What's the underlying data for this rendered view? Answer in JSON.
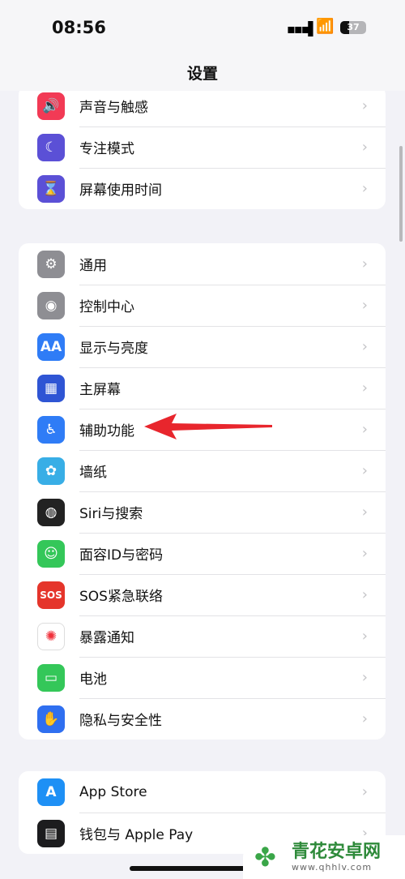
{
  "status": {
    "time": "08:56",
    "battery": "37"
  },
  "header": {
    "title": "设置"
  },
  "groups": [
    [
      {
        "label": "声音与触感",
        "icon": "speaker-icon",
        "color": "#f23a55",
        "glyph": "🔊"
      },
      {
        "label": "专注模式",
        "icon": "moon-icon",
        "color": "#5b50d6",
        "glyph": "☾"
      },
      {
        "label": "屏幕使用时间",
        "icon": "hourglass-icon",
        "color": "#5b50d6",
        "glyph": "⌛"
      }
    ],
    [
      {
        "label": "通用",
        "icon": "gear-icon",
        "color": "#8e8e93",
        "glyph": "⚙"
      },
      {
        "label": "控制中心",
        "icon": "toggles-icon",
        "color": "#8e8e93",
        "glyph": "◉"
      },
      {
        "label": "显示与亮度",
        "icon": "text-size-icon",
        "color": "#2f7cf6",
        "glyph": "AA"
      },
      {
        "label": "主屏幕",
        "icon": "home-grid-icon",
        "color": "#2f55d4",
        "glyph": "▦"
      },
      {
        "label": "辅助功能",
        "icon": "accessibility-icon",
        "color": "#2f7cf6",
        "glyph": "♿"
      },
      {
        "label": "墙纸",
        "icon": "flower-icon",
        "color": "#38aee6",
        "glyph": "✿"
      },
      {
        "label": "Siri与搜索",
        "icon": "siri-icon",
        "color": "#222",
        "glyph": "◍"
      },
      {
        "label": "面容ID与密码",
        "icon": "face-id-icon",
        "color": "#34c759",
        "glyph": "☺"
      },
      {
        "label": "SOS紧急联络",
        "icon": "sos-icon",
        "color": "#e5352b",
        "glyph": "SOS"
      },
      {
        "label": "暴露通知",
        "icon": "exposure-icon",
        "color": "#fff",
        "glyph": "✺"
      },
      {
        "label": "电池",
        "icon": "battery-icon",
        "color": "#34c759",
        "glyph": "▭"
      },
      {
        "label": "隐私与安全性",
        "icon": "hand-icon",
        "color": "#2f6ff0",
        "glyph": "✋"
      }
    ],
    [
      {
        "label": "App Store",
        "icon": "app-store-icon",
        "color": "#1e90f5",
        "glyph": "A"
      },
      {
        "label": "钱包与 Apple Pay",
        "icon": "wallet-icon",
        "color": "#1c1c1e",
        "glyph": "▤"
      }
    ]
  ],
  "watermark": {
    "name": "青花安卓网",
    "url": "www.qhhlv.com"
  },
  "annotation": {
    "arrow_color": "#e8262d"
  }
}
